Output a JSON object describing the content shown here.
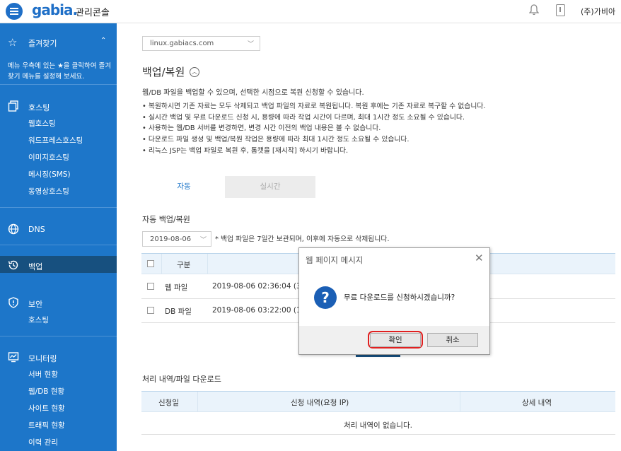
{
  "header": {
    "logo": "gabia.",
    "console_title": "관리콘솔",
    "company": "(주)가비아"
  },
  "sidebar": {
    "favorites_label": "즐겨찾기",
    "favorites_note": "메뉴 우측에 있는 ★을 클릭하여 즐겨찾기 메뉴를 설정해 보세요.",
    "groups": [
      {
        "label": "호스팅",
        "items": [
          "웹호스팅",
          "워드프레스호스팅",
          "이미지호스팅",
          "메시징(SMS)",
          "동영상호스팅"
        ]
      },
      {
        "label": "DNS",
        "items": []
      },
      {
        "label": "백업",
        "items": []
      },
      {
        "label": "보안",
        "items": [
          "호스팅"
        ]
      },
      {
        "label": "모니터링",
        "items": [
          "서버 현황",
          "웹/DB 현황",
          "사이트 현황",
          "트래픽 현황",
          "이력 관리"
        ]
      }
    ]
  },
  "main": {
    "server_select": "linux.gabiacs.com",
    "title": "백업/복원",
    "description": "웹/DB 파일을 백업할 수 있으며, 선택한 시점으로 복원 신청할 수 있습니다.",
    "bullets": [
      "복원하시면 기존 자료는 모두 삭제되고 백업 파일의 자료로 복원됩니다. 복원 후에는 기존 자료로 복구할 수 없습니다.",
      "실시간 백업 및 무료 다운로드 신청 시, 용량에 따라 작업 시간이 다르며, 최대 1시간 정도 소요될 수 있습니다.",
      "사용하는 웹/DB 서버를 변경하면, 변경 시간 이전의 백업 내용은 볼 수 없습니다.",
      "다운로드 파일 생성 및 백업/복원 작업은 용량에 따라 최대 1시간 정도 소요될 수 있습니다.",
      "리눅스 JSP는 백업 파일로 복원 후, 톰캣을 [재시작] 하시기 바랍니다."
    ],
    "tabs": [
      "자동",
      "실시간"
    ],
    "auto_section_label": "자동 백업/복원",
    "date_select": "2019-08-06",
    "date_note": "* 백업 파일은 7일간 보관되며, 이후에 자동으로 삭제됩니다.",
    "backup_table": {
      "headers": [
        "구분"
      ],
      "rows": [
        {
          "type": "웹 파일",
          "datetime": "2019-08-06 02:36:04 (35"
        },
        {
          "type": "DB 파일",
          "datetime": "2019-08-06 03:22:00 (13"
        }
      ]
    },
    "history_section_label": "처리 내역/파일 다운로드",
    "history_table": {
      "headers": [
        "신청일",
        "신청 내역(요청 IP)",
        "상세 내역"
      ],
      "empty": "처리 내역이 없습니다."
    }
  },
  "dialog": {
    "title": "웹 페이지 메시지",
    "message": "무료 다운로드를 신청하시겠습니까?",
    "ok_label": "확인",
    "cancel_label": "취소"
  }
}
